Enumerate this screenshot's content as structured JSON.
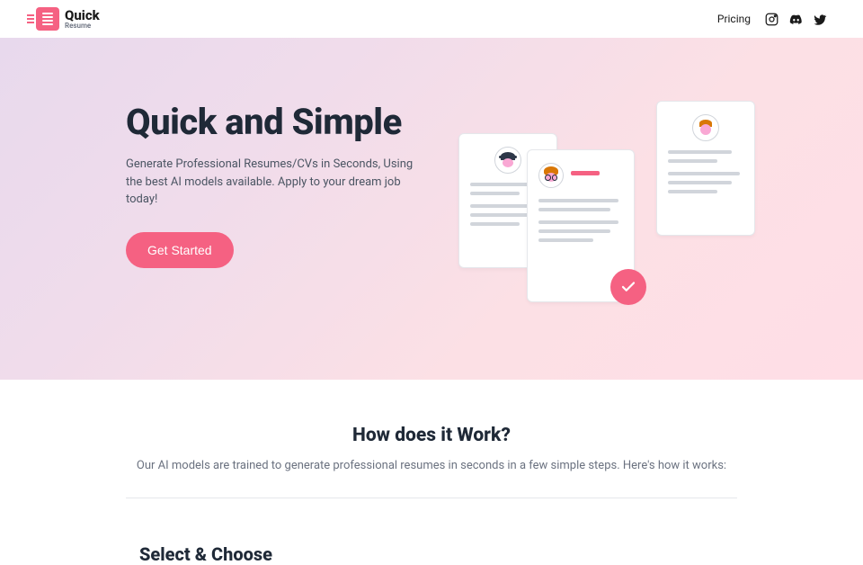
{
  "brand": {
    "title": "Quick",
    "subtitle": "Resume"
  },
  "nav": {
    "pricing": "Pricing"
  },
  "hero": {
    "title": "Quick and Simple",
    "description": "Generate Professional Resumes/CVs in Seconds, Using the best AI models available. Apply to your dream job today!",
    "cta": "Get Started"
  },
  "section2": {
    "title": "How does it Work?",
    "description": "Our AI models are trained to generate professional resumes in seconds in a few simple steps. Here's how it works:"
  },
  "step1": {
    "title": "Select & Choose"
  }
}
